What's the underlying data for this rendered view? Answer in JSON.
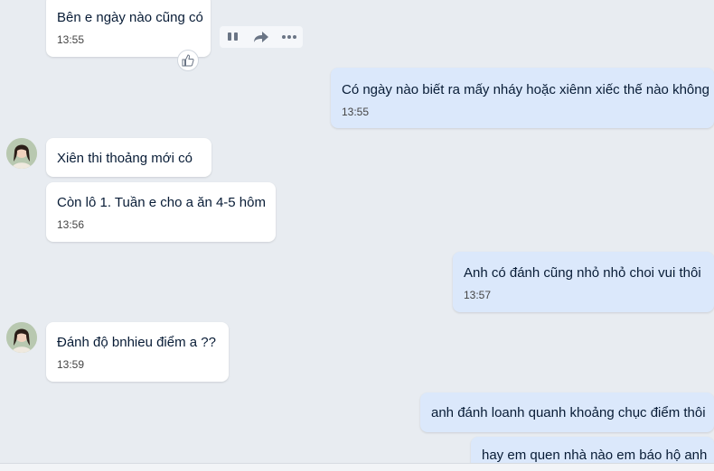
{
  "messages": [
    {
      "text": "Bên e ngày nào cũng có",
      "time": "13:55"
    },
    {
      "text": "Có ngày nào biết ra mấy nháy hoặc xiênn xiếc thế nào không",
      "time": "13:55"
    },
    {
      "text": " Xiên thi thoảng mới có"
    },
    {
      "text": "Còn lô 1. Tuần e cho a ăn 4-5 hôm",
      "time": "13:56"
    },
    {
      "text": "Anh có đánh  cũng nhỏ nhỏ choi vui thôi",
      "time": "13:57"
    },
    {
      "text": "Đánh độ bnhieu điểm a ??",
      "time": "13:59"
    },
    {
      "text": "anh đánh loanh quanh khoảng chục điểm thôi"
    },
    {
      "text": "hay em quen nhà nào em báo hộ anh"
    }
  ],
  "toolbar": {
    "icons": [
      "quote-icon",
      "forward-icon",
      "more-icon"
    ],
    "like_icon": "thumbs-up-icon"
  },
  "colors": {
    "background": "#e8ecf1",
    "incoming_bubble": "#ffffff",
    "outgoing_bubble": "#dbe8fb"
  }
}
